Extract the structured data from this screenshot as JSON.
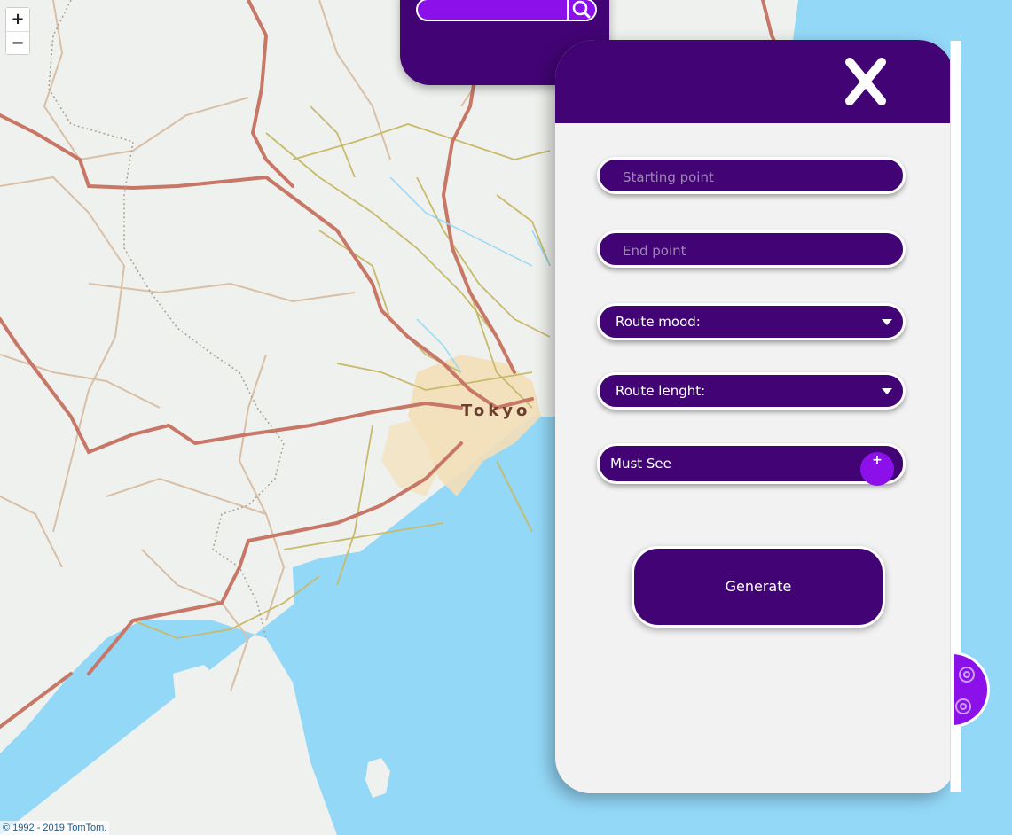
{
  "map": {
    "city_label": "Tokyo",
    "attribution": "© 1992 - 2019 TomTom.",
    "zoom_in_label": "+",
    "zoom_out_label": "−"
  },
  "search": {
    "placeholder": "",
    "icon": "search-icon"
  },
  "route_panel": {
    "close_icon": "close-icon",
    "starting_point_placeholder": "Starting point",
    "end_point_placeholder": "End point",
    "route_mood_label": "Route mood:",
    "route_length_label": "Route lenght:",
    "must_see_label": "Must See",
    "must_see_add_label": "+",
    "generate_label": "Generate"
  },
  "colors": {
    "primary": "#420474",
    "accent": "#8b10ea",
    "panel_bg": "#f2f2f2",
    "water": "#94d8f8",
    "land": "#eff1ee"
  }
}
